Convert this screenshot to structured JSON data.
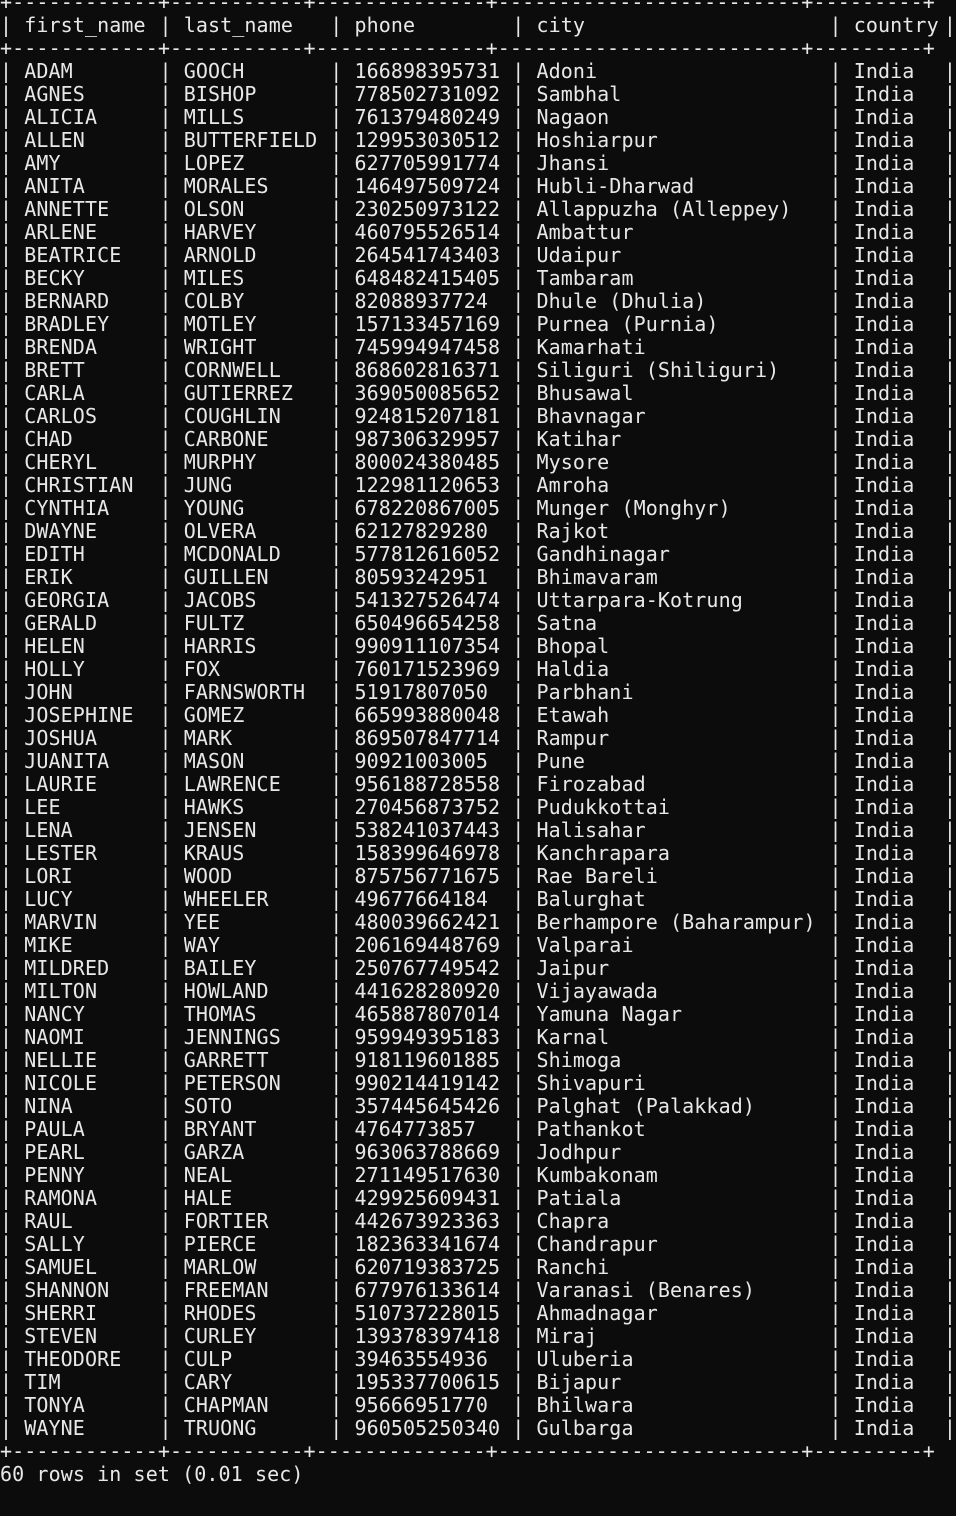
{
  "terminal": {
    "top_border": "+------------+-----------+--------------+-------------------------+---------+",
    "header_sep": "+------------+-----------+--------------+-------------------------+---------+",
    "bottom_border": "+------------+-----------+--------------+-------------------------+---------+",
    "columns": [
      "first_name",
      "last_name",
      "phone",
      "city",
      "country"
    ],
    "rows": [
      [
        "ADAM",
        "GOOCH",
        "166898395731",
        "Adoni",
        "India"
      ],
      [
        "AGNES",
        "BISHOP",
        "778502731092",
        "Sambhal",
        "India"
      ],
      [
        "ALICIA",
        "MILLS",
        "761379480249",
        "Nagaon",
        "India"
      ],
      [
        "ALLEN",
        "BUTTERFIELD",
        "129953030512",
        "Hoshiarpur",
        "India"
      ],
      [
        "AMY",
        "LOPEZ",
        "627705991774",
        "Jhansi",
        "India"
      ],
      [
        "ANITA",
        "MORALES",
        "146497509724",
        "Hubli-Dharwad",
        "India"
      ],
      [
        "ANNETTE",
        "OLSON",
        "230250973122",
        "Allappuzha (Alleppey)",
        "India"
      ],
      [
        "ARLENE",
        "HARVEY",
        "460795526514",
        "Ambattur",
        "India"
      ],
      [
        "BEATRICE",
        "ARNOLD",
        "264541743403",
        "Udaipur",
        "India"
      ],
      [
        "BECKY",
        "MILES",
        "648482415405",
        "Tambaram",
        "India"
      ],
      [
        "BERNARD",
        "COLBY",
        "82088937724",
        "Dhule (Dhulia)",
        "India"
      ],
      [
        "BRADLEY",
        "MOTLEY",
        "157133457169",
        "Purnea (Purnia)",
        "India"
      ],
      [
        "BRENDA",
        "WRIGHT",
        "745994947458",
        "Kamarhati",
        "India"
      ],
      [
        "BRETT",
        "CORNWELL",
        "868602816371",
        "Siliguri (Shiliguri)",
        "India"
      ],
      [
        "CARLA",
        "GUTIERREZ",
        "369050085652",
        "Bhusawal",
        "India"
      ],
      [
        "CARLOS",
        "COUGHLIN",
        "924815207181",
        "Bhavnagar",
        "India"
      ],
      [
        "CHAD",
        "CARBONE",
        "987306329957",
        "Katihar",
        "India"
      ],
      [
        "CHERYL",
        "MURPHY",
        "800024380485",
        "Mysore",
        "India"
      ],
      [
        "CHRISTIAN",
        "JUNG",
        "122981120653",
        "Amroha",
        "India"
      ],
      [
        "CYNTHIA",
        "YOUNG",
        "678220867005",
        "Munger (Monghyr)",
        "India"
      ],
      [
        "DWAYNE",
        "OLVERA",
        "62127829280",
        "Rajkot",
        "India"
      ],
      [
        "EDITH",
        "MCDONALD",
        "577812616052",
        "Gandhinagar",
        "India"
      ],
      [
        "ERIK",
        "GUILLEN",
        "80593242951",
        "Bhimavaram",
        "India"
      ],
      [
        "GEORGIA",
        "JACOBS",
        "541327526474",
        "Uttarpara-Kotrung",
        "India"
      ],
      [
        "GERALD",
        "FULTZ",
        "650496654258",
        "Satna",
        "India"
      ],
      [
        "HELEN",
        "HARRIS",
        "990911107354",
        "Bhopal",
        "India"
      ],
      [
        "HOLLY",
        "FOX",
        "760171523969",
        "Haldia",
        "India"
      ],
      [
        "JOHN",
        "FARNSWORTH",
        "51917807050",
        "Parbhani",
        "India"
      ],
      [
        "JOSEPHINE",
        "GOMEZ",
        "665993880048",
        "Etawah",
        "India"
      ],
      [
        "JOSHUA",
        "MARK",
        "869507847714",
        "Rampur",
        "India"
      ],
      [
        "JUANITA",
        "MASON",
        "90921003005",
        "Pune",
        "India"
      ],
      [
        "LAURIE",
        "LAWRENCE",
        "956188728558",
        "Firozabad",
        "India"
      ],
      [
        "LEE",
        "HAWKS",
        "270456873752",
        "Pudukkottai",
        "India"
      ],
      [
        "LENA",
        "JENSEN",
        "538241037443",
        "Halisahar",
        "India"
      ],
      [
        "LESTER",
        "KRAUS",
        "158399646978",
        "Kanchrapara",
        "India"
      ],
      [
        "LORI",
        "WOOD",
        "875756771675",
        "Rae Bareli",
        "India"
      ],
      [
        "LUCY",
        "WHEELER",
        "49677664184",
        "Balurghat",
        "India"
      ],
      [
        "MARVIN",
        "YEE",
        "480039662421",
        "Berhampore (Baharampur)",
        "India"
      ],
      [
        "MIKE",
        "WAY",
        "206169448769",
        "Valparai",
        "India"
      ],
      [
        "MILDRED",
        "BAILEY",
        "250767749542",
        "Jaipur",
        "India"
      ],
      [
        "MILTON",
        "HOWLAND",
        "441628280920",
        "Vijayawada",
        "India"
      ],
      [
        "NANCY",
        "THOMAS",
        "465887807014",
        "Yamuna Nagar",
        "India"
      ],
      [
        "NAOMI",
        "JENNINGS",
        "959949395183",
        "Karnal",
        "India"
      ],
      [
        "NELLIE",
        "GARRETT",
        "918119601885",
        "Shimoga",
        "India"
      ],
      [
        "NICOLE",
        "PETERSON",
        "990214419142",
        "Shivapuri",
        "India"
      ],
      [
        "NINA",
        "SOTO",
        "357445645426",
        "Palghat (Palakkad)",
        "India"
      ],
      [
        "PAULA",
        "BRYANT",
        "4764773857",
        "Pathankot",
        "India"
      ],
      [
        "PEARL",
        "GARZA",
        "963063788669",
        "Jodhpur",
        "India"
      ],
      [
        "PENNY",
        "NEAL",
        "271149517630",
        "Kumbakonam",
        "India"
      ],
      [
        "RAMONA",
        "HALE",
        "429925609431",
        "Patiala",
        "India"
      ],
      [
        "RAUL",
        "FORTIER",
        "442673923363",
        "Chapra",
        "India"
      ],
      [
        "SALLY",
        "PIERCE",
        "182363341674",
        "Chandrapur",
        "India"
      ],
      [
        "SAMUEL",
        "MARLOW",
        "620719383725",
        "Ranchi",
        "India"
      ],
      [
        "SHANNON",
        "FREEMAN",
        "677976133614",
        "Varanasi (Benares)",
        "India"
      ],
      [
        "SHERRI",
        "RHODES",
        "510737228015",
        "Ahmadnagar",
        "India"
      ],
      [
        "STEVEN",
        "CURLEY",
        "139378397418",
        "Miraj",
        "India"
      ],
      [
        "THEODORE",
        "CULP",
        "39463554936",
        "Uluberia",
        "India"
      ],
      [
        "TIM",
        "CARY",
        "195337700615",
        "Bijapur",
        "India"
      ],
      [
        "TONYA",
        "CHAPMAN",
        "95666951770",
        "Bhilwara",
        "India"
      ],
      [
        "WAYNE",
        "TRUONG",
        "960505250340",
        "Gulbarga",
        "India"
      ]
    ],
    "summary": "60 rows in set (0.01 sec)"
  }
}
